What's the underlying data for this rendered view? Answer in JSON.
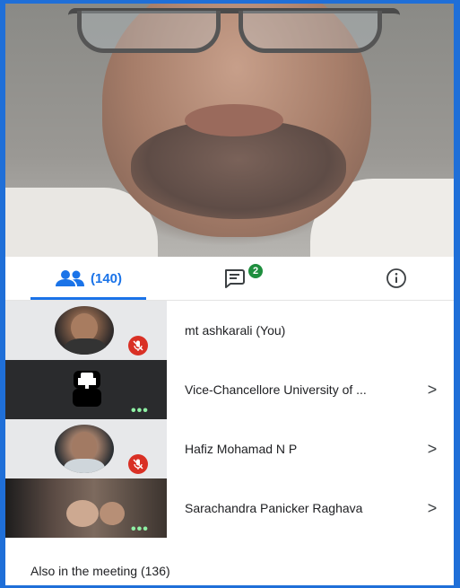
{
  "tabs": {
    "people_count": "(140)",
    "chat_badge": "2"
  },
  "participants": [
    {
      "name": "mt ashkarali (You)",
      "muted": true
    },
    {
      "name": "Vice-Chancellore University of ...",
      "muted": false
    },
    {
      "name": "Hafiz Mohamad N P",
      "muted": true
    },
    {
      "name": "Sarachandra Panicker Raghava",
      "muted": false
    }
  ],
  "chevron": ">",
  "also_in_meeting": "Also in the meeting (136)",
  "colors": {
    "accent": "#1a73e8",
    "mic_off": "#d93025",
    "badge": "#1e8e3e",
    "border": "#1f6fd8"
  }
}
